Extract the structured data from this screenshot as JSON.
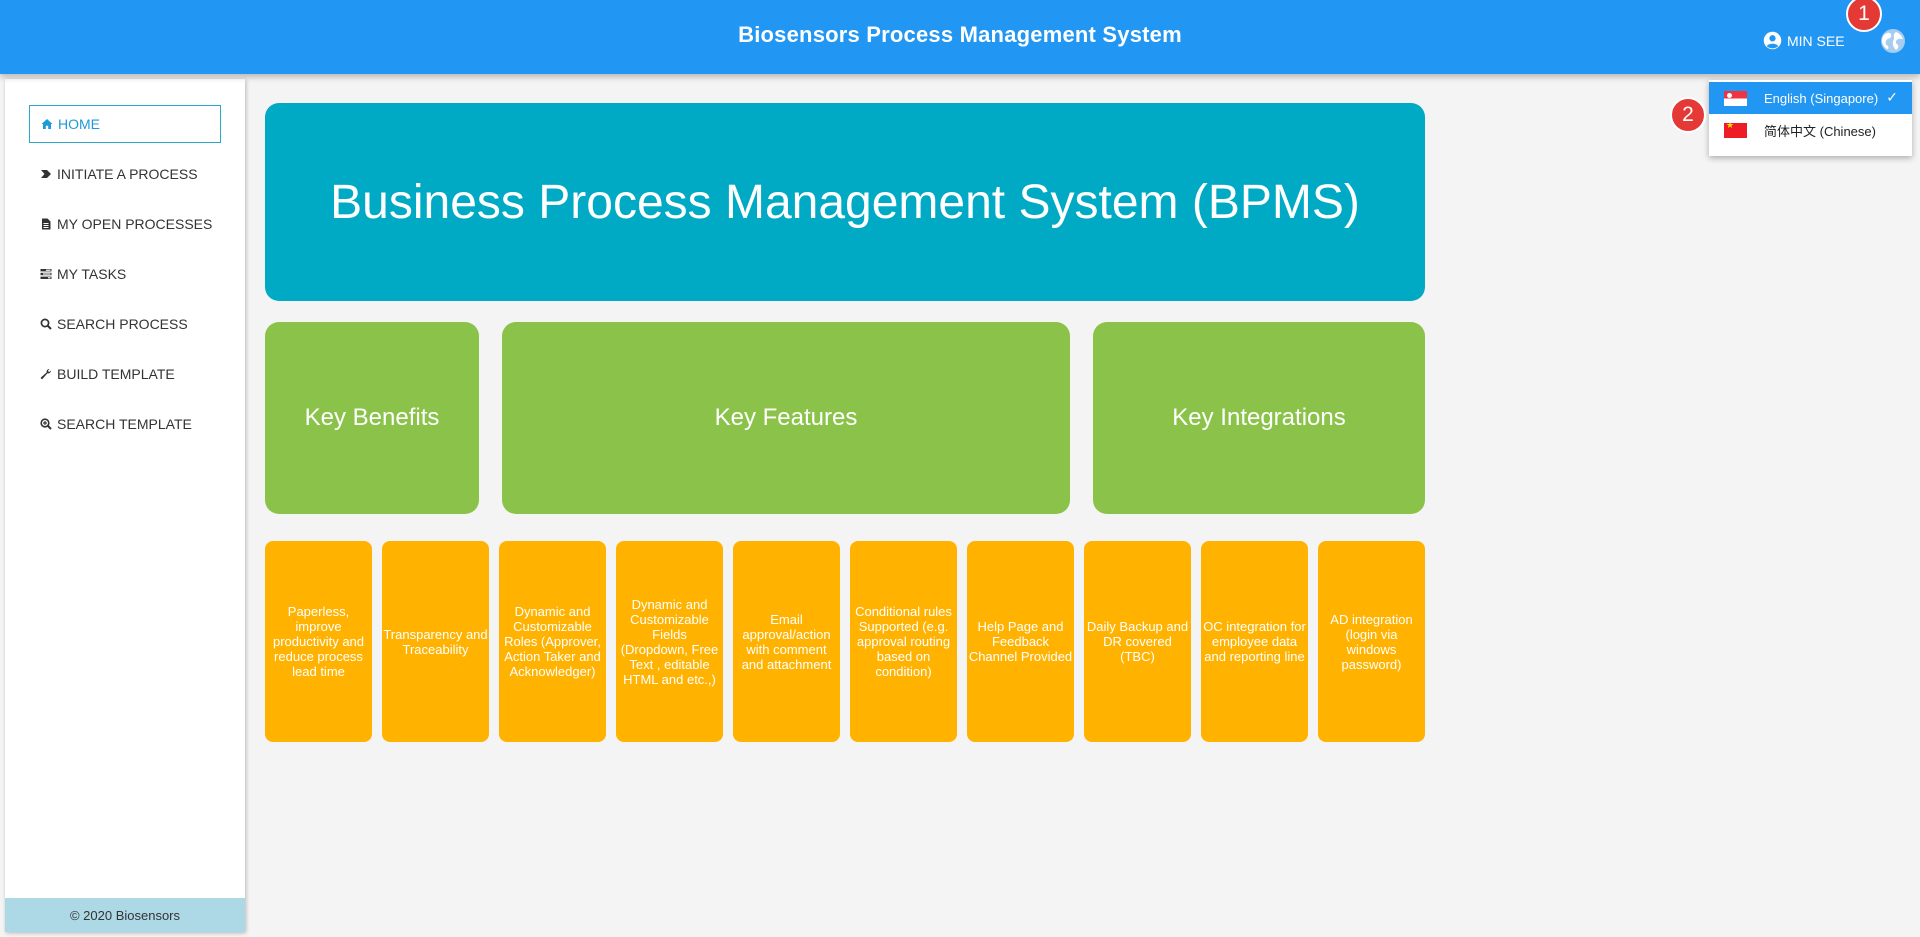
{
  "header": {
    "title": "Biosensors Process Management System",
    "user_name": "MIN SEE"
  },
  "markers": {
    "m1": "1",
    "m2": "2"
  },
  "language_menu": {
    "items": [
      {
        "label": "English (Singapore)",
        "selected": true,
        "flag": "sg-flag-icon",
        "check": "✓"
      },
      {
        "label": "简体中文 (Chinese)",
        "selected": false,
        "flag": "cn-flag-icon"
      }
    ]
  },
  "sidebar": {
    "items": [
      {
        "label": "HOME",
        "icon": "home-icon",
        "active": true
      },
      {
        "label": "INITIATE A PROCESS",
        "icon": "chevron-right-icon"
      },
      {
        "label": "MY OPEN PROCESSES",
        "icon": "file-icon"
      },
      {
        "label": "MY TASKS",
        "icon": "tasks-icon"
      },
      {
        "label": "SEARCH PROCESS",
        "icon": "search-icon"
      },
      {
        "label": "BUILD TEMPLATE",
        "icon": "wrench-icon"
      },
      {
        "label": "SEARCH TEMPLATE",
        "icon": "search-plus-icon"
      }
    ],
    "footer": "© 2020 Biosensors"
  },
  "main": {
    "banner": "Business Process Management System (BPMS)",
    "key_boxes": [
      "Key Benefits",
      "Key Features",
      "Key Integrations"
    ],
    "feature_tiles": [
      "Paperless, improve productivity and reduce process lead time",
      "Transparency and Traceability",
      "Dynamic and Customizable Roles (Approver, Action Taker and Acknowledger)",
      "Dynamic and Customizable Fields (Dropdown, Free Text , editable HTML and etc.,)",
      "Email approval/action with comment and attachment",
      "Conditional rules Supported (e.g. approval routing based on condition)",
      "Help Page and Feedback Channel Provided",
      "Daily Backup and DR covered (TBC)",
      "OC integration for employee data and reporting line",
      "AD integration (login via windows password)"
    ]
  },
  "colors": {
    "header": "#2196f3",
    "banner": "#00aac5",
    "key_box": "#8bc34a",
    "feature_tile": "#ffb300",
    "footer": "#add8e6",
    "marker": "#e53935"
  }
}
